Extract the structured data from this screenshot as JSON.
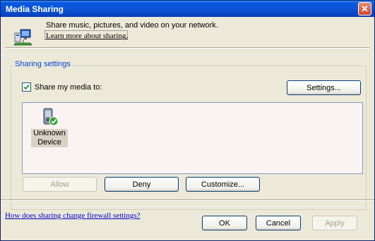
{
  "window": {
    "title": "Media Sharing",
    "close_glyph": "✕"
  },
  "header": {
    "icon": "media-sharing-network-icon",
    "description": "Share music, pictures, and video on your network.",
    "learn_more_link": "Learn more about sharing."
  },
  "sharing_settings": {
    "group_label": "Sharing settings",
    "share_checkbox_label": "Share my media to:",
    "share_checked": true,
    "settings_button": "Settings...",
    "devices": [
      {
        "name": "Unknown Device",
        "line1": "Unknown",
        "line2": "Device",
        "icon": "device-allowed-check-icon"
      }
    ],
    "allow_button": "Allow",
    "deny_button": "Deny",
    "customize_button": "Customize..."
  },
  "footer": {
    "firewall_link": "How does sharing change firewall settings?",
    "ok_button": "OK",
    "cancel_button": "Cancel",
    "apply_button": "Apply"
  },
  "colors": {
    "titlebar": "#0a58df",
    "group_label": "#0046d5",
    "link": "#0000cc",
    "list_background": "#fbf2f2"
  }
}
